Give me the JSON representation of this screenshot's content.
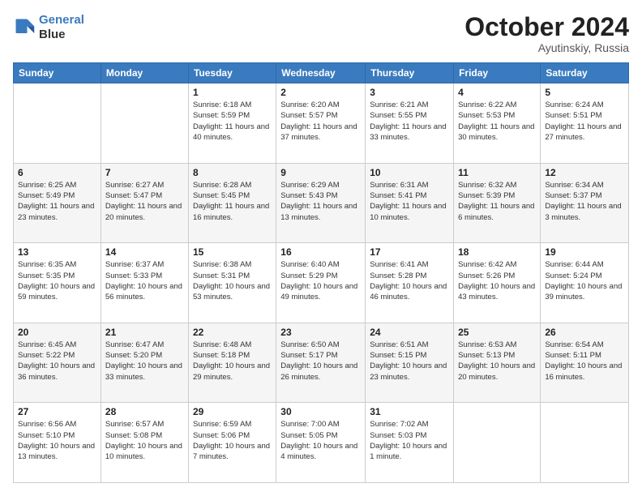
{
  "logo": {
    "line1": "General",
    "line2": "Blue"
  },
  "header": {
    "month": "October 2024",
    "location": "Ayutinskiy, Russia"
  },
  "weekdays": [
    "Sunday",
    "Monday",
    "Tuesday",
    "Wednesday",
    "Thursday",
    "Friday",
    "Saturday"
  ],
  "weeks": [
    [
      {
        "day": "",
        "sunrise": "",
        "sunset": "",
        "daylight": ""
      },
      {
        "day": "",
        "sunrise": "",
        "sunset": "",
        "daylight": ""
      },
      {
        "day": "1",
        "sunrise": "Sunrise: 6:18 AM",
        "sunset": "Sunset: 5:59 PM",
        "daylight": "Daylight: 11 hours and 40 minutes."
      },
      {
        "day": "2",
        "sunrise": "Sunrise: 6:20 AM",
        "sunset": "Sunset: 5:57 PM",
        "daylight": "Daylight: 11 hours and 37 minutes."
      },
      {
        "day": "3",
        "sunrise": "Sunrise: 6:21 AM",
        "sunset": "Sunset: 5:55 PM",
        "daylight": "Daylight: 11 hours and 33 minutes."
      },
      {
        "day": "4",
        "sunrise": "Sunrise: 6:22 AM",
        "sunset": "Sunset: 5:53 PM",
        "daylight": "Daylight: 11 hours and 30 minutes."
      },
      {
        "day": "5",
        "sunrise": "Sunrise: 6:24 AM",
        "sunset": "Sunset: 5:51 PM",
        "daylight": "Daylight: 11 hours and 27 minutes."
      }
    ],
    [
      {
        "day": "6",
        "sunrise": "Sunrise: 6:25 AM",
        "sunset": "Sunset: 5:49 PM",
        "daylight": "Daylight: 11 hours and 23 minutes."
      },
      {
        "day": "7",
        "sunrise": "Sunrise: 6:27 AM",
        "sunset": "Sunset: 5:47 PM",
        "daylight": "Daylight: 11 hours and 20 minutes."
      },
      {
        "day": "8",
        "sunrise": "Sunrise: 6:28 AM",
        "sunset": "Sunset: 5:45 PM",
        "daylight": "Daylight: 11 hours and 16 minutes."
      },
      {
        "day": "9",
        "sunrise": "Sunrise: 6:29 AM",
        "sunset": "Sunset: 5:43 PM",
        "daylight": "Daylight: 11 hours and 13 minutes."
      },
      {
        "day": "10",
        "sunrise": "Sunrise: 6:31 AM",
        "sunset": "Sunset: 5:41 PM",
        "daylight": "Daylight: 11 hours and 10 minutes."
      },
      {
        "day": "11",
        "sunrise": "Sunrise: 6:32 AM",
        "sunset": "Sunset: 5:39 PM",
        "daylight": "Daylight: 11 hours and 6 minutes."
      },
      {
        "day": "12",
        "sunrise": "Sunrise: 6:34 AM",
        "sunset": "Sunset: 5:37 PM",
        "daylight": "Daylight: 11 hours and 3 minutes."
      }
    ],
    [
      {
        "day": "13",
        "sunrise": "Sunrise: 6:35 AM",
        "sunset": "Sunset: 5:35 PM",
        "daylight": "Daylight: 10 hours and 59 minutes."
      },
      {
        "day": "14",
        "sunrise": "Sunrise: 6:37 AM",
        "sunset": "Sunset: 5:33 PM",
        "daylight": "Daylight: 10 hours and 56 minutes."
      },
      {
        "day": "15",
        "sunrise": "Sunrise: 6:38 AM",
        "sunset": "Sunset: 5:31 PM",
        "daylight": "Daylight: 10 hours and 53 minutes."
      },
      {
        "day": "16",
        "sunrise": "Sunrise: 6:40 AM",
        "sunset": "Sunset: 5:29 PM",
        "daylight": "Daylight: 10 hours and 49 minutes."
      },
      {
        "day": "17",
        "sunrise": "Sunrise: 6:41 AM",
        "sunset": "Sunset: 5:28 PM",
        "daylight": "Daylight: 10 hours and 46 minutes."
      },
      {
        "day": "18",
        "sunrise": "Sunrise: 6:42 AM",
        "sunset": "Sunset: 5:26 PM",
        "daylight": "Daylight: 10 hours and 43 minutes."
      },
      {
        "day": "19",
        "sunrise": "Sunrise: 6:44 AM",
        "sunset": "Sunset: 5:24 PM",
        "daylight": "Daylight: 10 hours and 39 minutes."
      }
    ],
    [
      {
        "day": "20",
        "sunrise": "Sunrise: 6:45 AM",
        "sunset": "Sunset: 5:22 PM",
        "daylight": "Daylight: 10 hours and 36 minutes."
      },
      {
        "day": "21",
        "sunrise": "Sunrise: 6:47 AM",
        "sunset": "Sunset: 5:20 PM",
        "daylight": "Daylight: 10 hours and 33 minutes."
      },
      {
        "day": "22",
        "sunrise": "Sunrise: 6:48 AM",
        "sunset": "Sunset: 5:18 PM",
        "daylight": "Daylight: 10 hours and 29 minutes."
      },
      {
        "day": "23",
        "sunrise": "Sunrise: 6:50 AM",
        "sunset": "Sunset: 5:17 PM",
        "daylight": "Daylight: 10 hours and 26 minutes."
      },
      {
        "day": "24",
        "sunrise": "Sunrise: 6:51 AM",
        "sunset": "Sunset: 5:15 PM",
        "daylight": "Daylight: 10 hours and 23 minutes."
      },
      {
        "day": "25",
        "sunrise": "Sunrise: 6:53 AM",
        "sunset": "Sunset: 5:13 PM",
        "daylight": "Daylight: 10 hours and 20 minutes."
      },
      {
        "day": "26",
        "sunrise": "Sunrise: 6:54 AM",
        "sunset": "Sunset: 5:11 PM",
        "daylight": "Daylight: 10 hours and 16 minutes."
      }
    ],
    [
      {
        "day": "27",
        "sunrise": "Sunrise: 6:56 AM",
        "sunset": "Sunset: 5:10 PM",
        "daylight": "Daylight: 10 hours and 13 minutes."
      },
      {
        "day": "28",
        "sunrise": "Sunrise: 6:57 AM",
        "sunset": "Sunset: 5:08 PM",
        "daylight": "Daylight: 10 hours and 10 minutes."
      },
      {
        "day": "29",
        "sunrise": "Sunrise: 6:59 AM",
        "sunset": "Sunset: 5:06 PM",
        "daylight": "Daylight: 10 hours and 7 minutes."
      },
      {
        "day": "30",
        "sunrise": "Sunrise: 7:00 AM",
        "sunset": "Sunset: 5:05 PM",
        "daylight": "Daylight: 10 hours and 4 minutes."
      },
      {
        "day": "31",
        "sunrise": "Sunrise: 7:02 AM",
        "sunset": "Sunset: 5:03 PM",
        "daylight": "Daylight: 10 hours and 1 minute."
      },
      {
        "day": "",
        "sunrise": "",
        "sunset": "",
        "daylight": ""
      },
      {
        "day": "",
        "sunrise": "",
        "sunset": "",
        "daylight": ""
      }
    ]
  ]
}
